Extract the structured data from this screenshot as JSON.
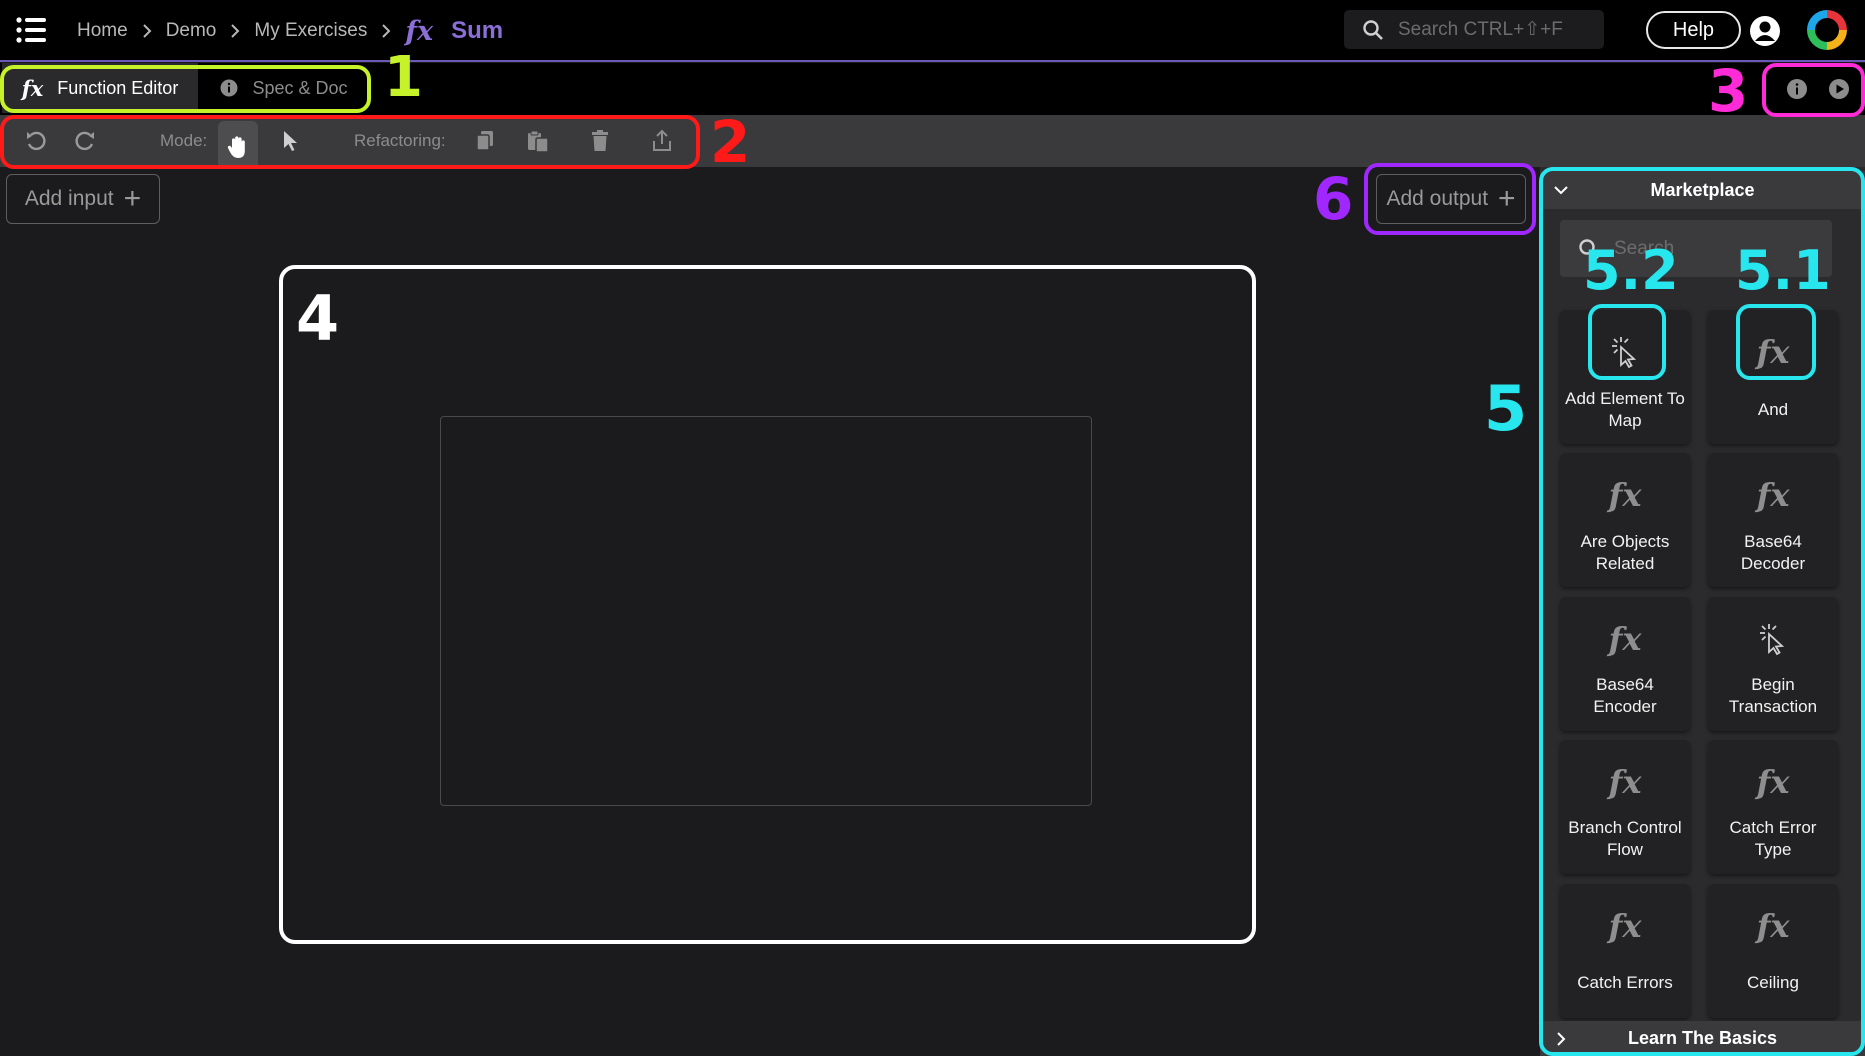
{
  "header": {
    "breadcrumb": [
      "Home",
      "Demo",
      "My Exercises"
    ],
    "current_icon": "fx",
    "current": "Sum",
    "search_placeholder": "Search CTRL+⇧+F",
    "help_label": "Help"
  },
  "tabs": [
    {
      "icon": "fx",
      "label": "Function Editor",
      "active": true
    },
    {
      "icon": "info-icon",
      "label": "Spec & Doc",
      "active": false
    }
  ],
  "toolbar": {
    "mode_label": "Mode:",
    "refactoring_label": "Refactoring:"
  },
  "canvas": {
    "add_input_label": "Add input",
    "add_output_label": "Add output",
    "plus": "+"
  },
  "marketplace": {
    "title": "Marketplace",
    "search_placeholder": "Search",
    "items": [
      {
        "label": "Add Element To Map",
        "icon": "cursor-click-icon"
      },
      {
        "label": "And",
        "icon": "fx"
      },
      {
        "label": "Are Objects Related",
        "icon": "fx"
      },
      {
        "label": "Base64 Decoder",
        "icon": "fx"
      },
      {
        "label": "Base64 Encoder",
        "icon": "fx"
      },
      {
        "label": "Begin Transaction",
        "icon": "cursor-click-icon"
      },
      {
        "label": "Branch Control Flow",
        "icon": "fx"
      },
      {
        "label": "Catch Error Type",
        "icon": "fx"
      },
      {
        "label": "Catch Errors",
        "icon": "fx"
      },
      {
        "label": "Ceiling",
        "icon": "fx"
      }
    ],
    "learn_label": "Learn The Basics"
  },
  "annotations": {
    "n1": "1",
    "n2": "2",
    "n3": "3",
    "n4": "4",
    "n5": "5",
    "n51": "5.1",
    "n52": "5.2",
    "n6": "6"
  },
  "colors": {
    "accent_purple": "#8b6fd6",
    "ann_1": "#c6f22a",
    "ann_2": "#ff1a1a",
    "ann_3": "#ff2bd6",
    "ann_4": "#ffffff",
    "ann_5": "#27e6ee",
    "ann_6": "#a028ff"
  }
}
